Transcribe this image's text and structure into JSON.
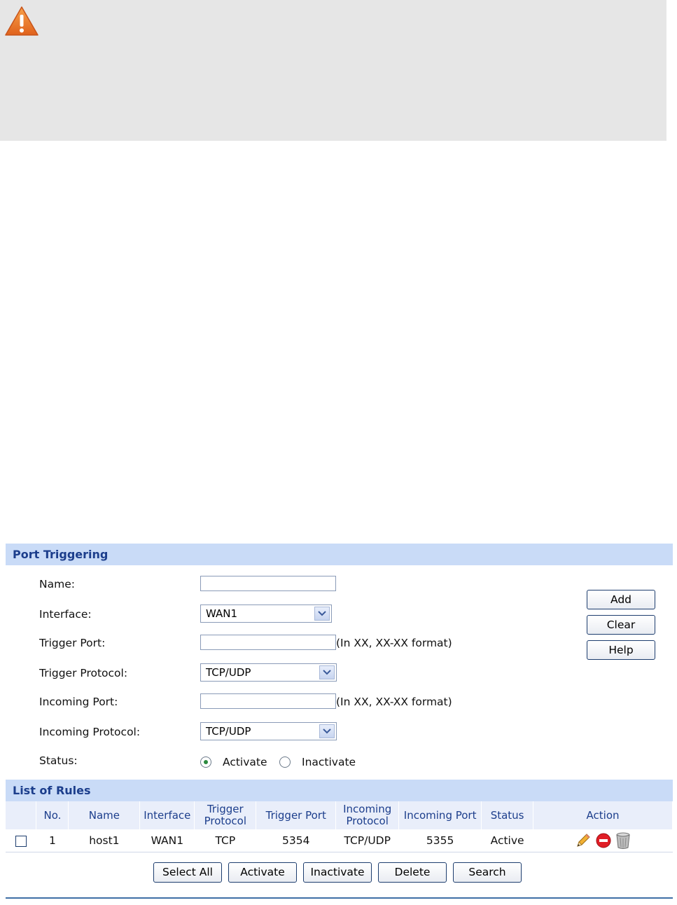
{
  "note": {
    "icon": "warning-icon"
  },
  "port_triggering": {
    "title": "Port Triggering",
    "labels": {
      "name": "Name:",
      "interface": "Interface:",
      "trigger_port": "Trigger Port:",
      "trigger_protocol": "Trigger Protocol:",
      "incoming_port": "Incoming Port:",
      "incoming_protocol": "Incoming Protocol:",
      "status": "Status:"
    },
    "values": {
      "name": "",
      "interface": "WAN1",
      "trigger_port": "",
      "trigger_protocol": "TCP/UDP",
      "incoming_port": "",
      "incoming_protocol": "TCP/UDP"
    },
    "hints": {
      "trigger_port": "(In XX, XX-XX format)",
      "incoming_port": "(In XX, XX-XX format)"
    },
    "status_options": {
      "activate": "Activate",
      "inactivate": "Inactivate",
      "selected": "Activate"
    },
    "buttons": {
      "add": "Add",
      "clear": "Clear",
      "help": "Help"
    }
  },
  "list_of_rules": {
    "title": "List of Rules",
    "columns": {
      "no": "No.",
      "name": "Name",
      "interface": "Interface",
      "trigger_protocol_1": "Trigger",
      "trigger_protocol_2": "Protocol",
      "trigger_port": "Trigger Port",
      "incoming_protocol_1": "Incoming",
      "incoming_protocol_2": "Protocol",
      "incoming_port": "Incoming Port",
      "status": "Status",
      "action": "Action"
    },
    "rows": [
      {
        "no": "1",
        "name": "host1",
        "interface": "WAN1",
        "trigger_protocol": "TCP",
        "trigger_port": "5354",
        "incoming_protocol": "TCP/UDP",
        "incoming_port": "5355",
        "status": "Active",
        "actions": [
          "edit-icon",
          "disable-icon",
          "delete-icon"
        ]
      }
    ],
    "buttons": {
      "select_all": "Select All",
      "activate": "Activate",
      "inactivate": "Inactivate",
      "delete": "Delete",
      "search": "Search"
    }
  }
}
